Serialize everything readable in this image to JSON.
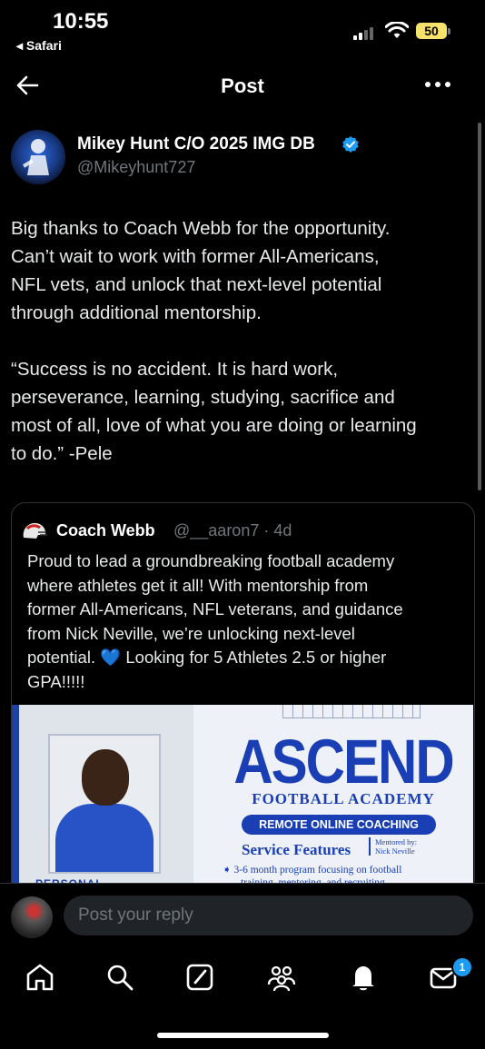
{
  "status_bar": {
    "time": "10:55",
    "back_app": "◂ Safari",
    "battery": "50"
  },
  "nav": {
    "title": "Post"
  },
  "post": {
    "author_name": "Mikey Hunt C/O 2025 IMG DB",
    "handle": "@Mikeyhunt727",
    "text": "Big thanks to Coach Webb for the opportunity.\nCan’t wait to work with former All-Americans,\nNFL vets, and unlock that next-level potential\nthrough additional mentorship.\n\n“Success is no accident. It is hard work,\nperseverance, learning, studying, sacrifice and\nmost of all, love of what you are doing or learning\nto do.” -Pele"
  },
  "quote": {
    "author_name": "Coach Webb",
    "meta": "@__aaron7 · 4d",
    "text": "Proud to lead a groundbreaking football academy\nwhere athletes get it all! With mentorship from\nformer All-Americans, NFL veterans, and guidance\nfrom Nick Neville, we’re unlocking next-level\npotential. 💙 Looking for 5 Athletes 2.5 or higher\nGPA!!!!!",
    "flyer": {
      "title": "ASCEND",
      "subtitle": "FOOTBALL ACADEMY",
      "pill": "REMOTE ONLINE COACHING",
      "service": "Service Features",
      "mentored": "Mentored by:\nNick Neville",
      "feature_line1": "3-6 month program focusing on football",
      "feature_line2": "training, mentoring, and recruiting",
      "personal": "PERSONAL"
    }
  },
  "reply": {
    "placeholder": "Post your reply"
  },
  "tabs": {
    "items": [
      "home-icon",
      "search-icon",
      "grok-icon",
      "communities-icon",
      "notifications-icon",
      "messages-icon"
    ],
    "messages_badge": "1"
  },
  "colors": {
    "background": "#000000",
    "accent": "#1d9bf0",
    "muted": "#71767b",
    "flyer_blue": "#1a3fb5"
  }
}
